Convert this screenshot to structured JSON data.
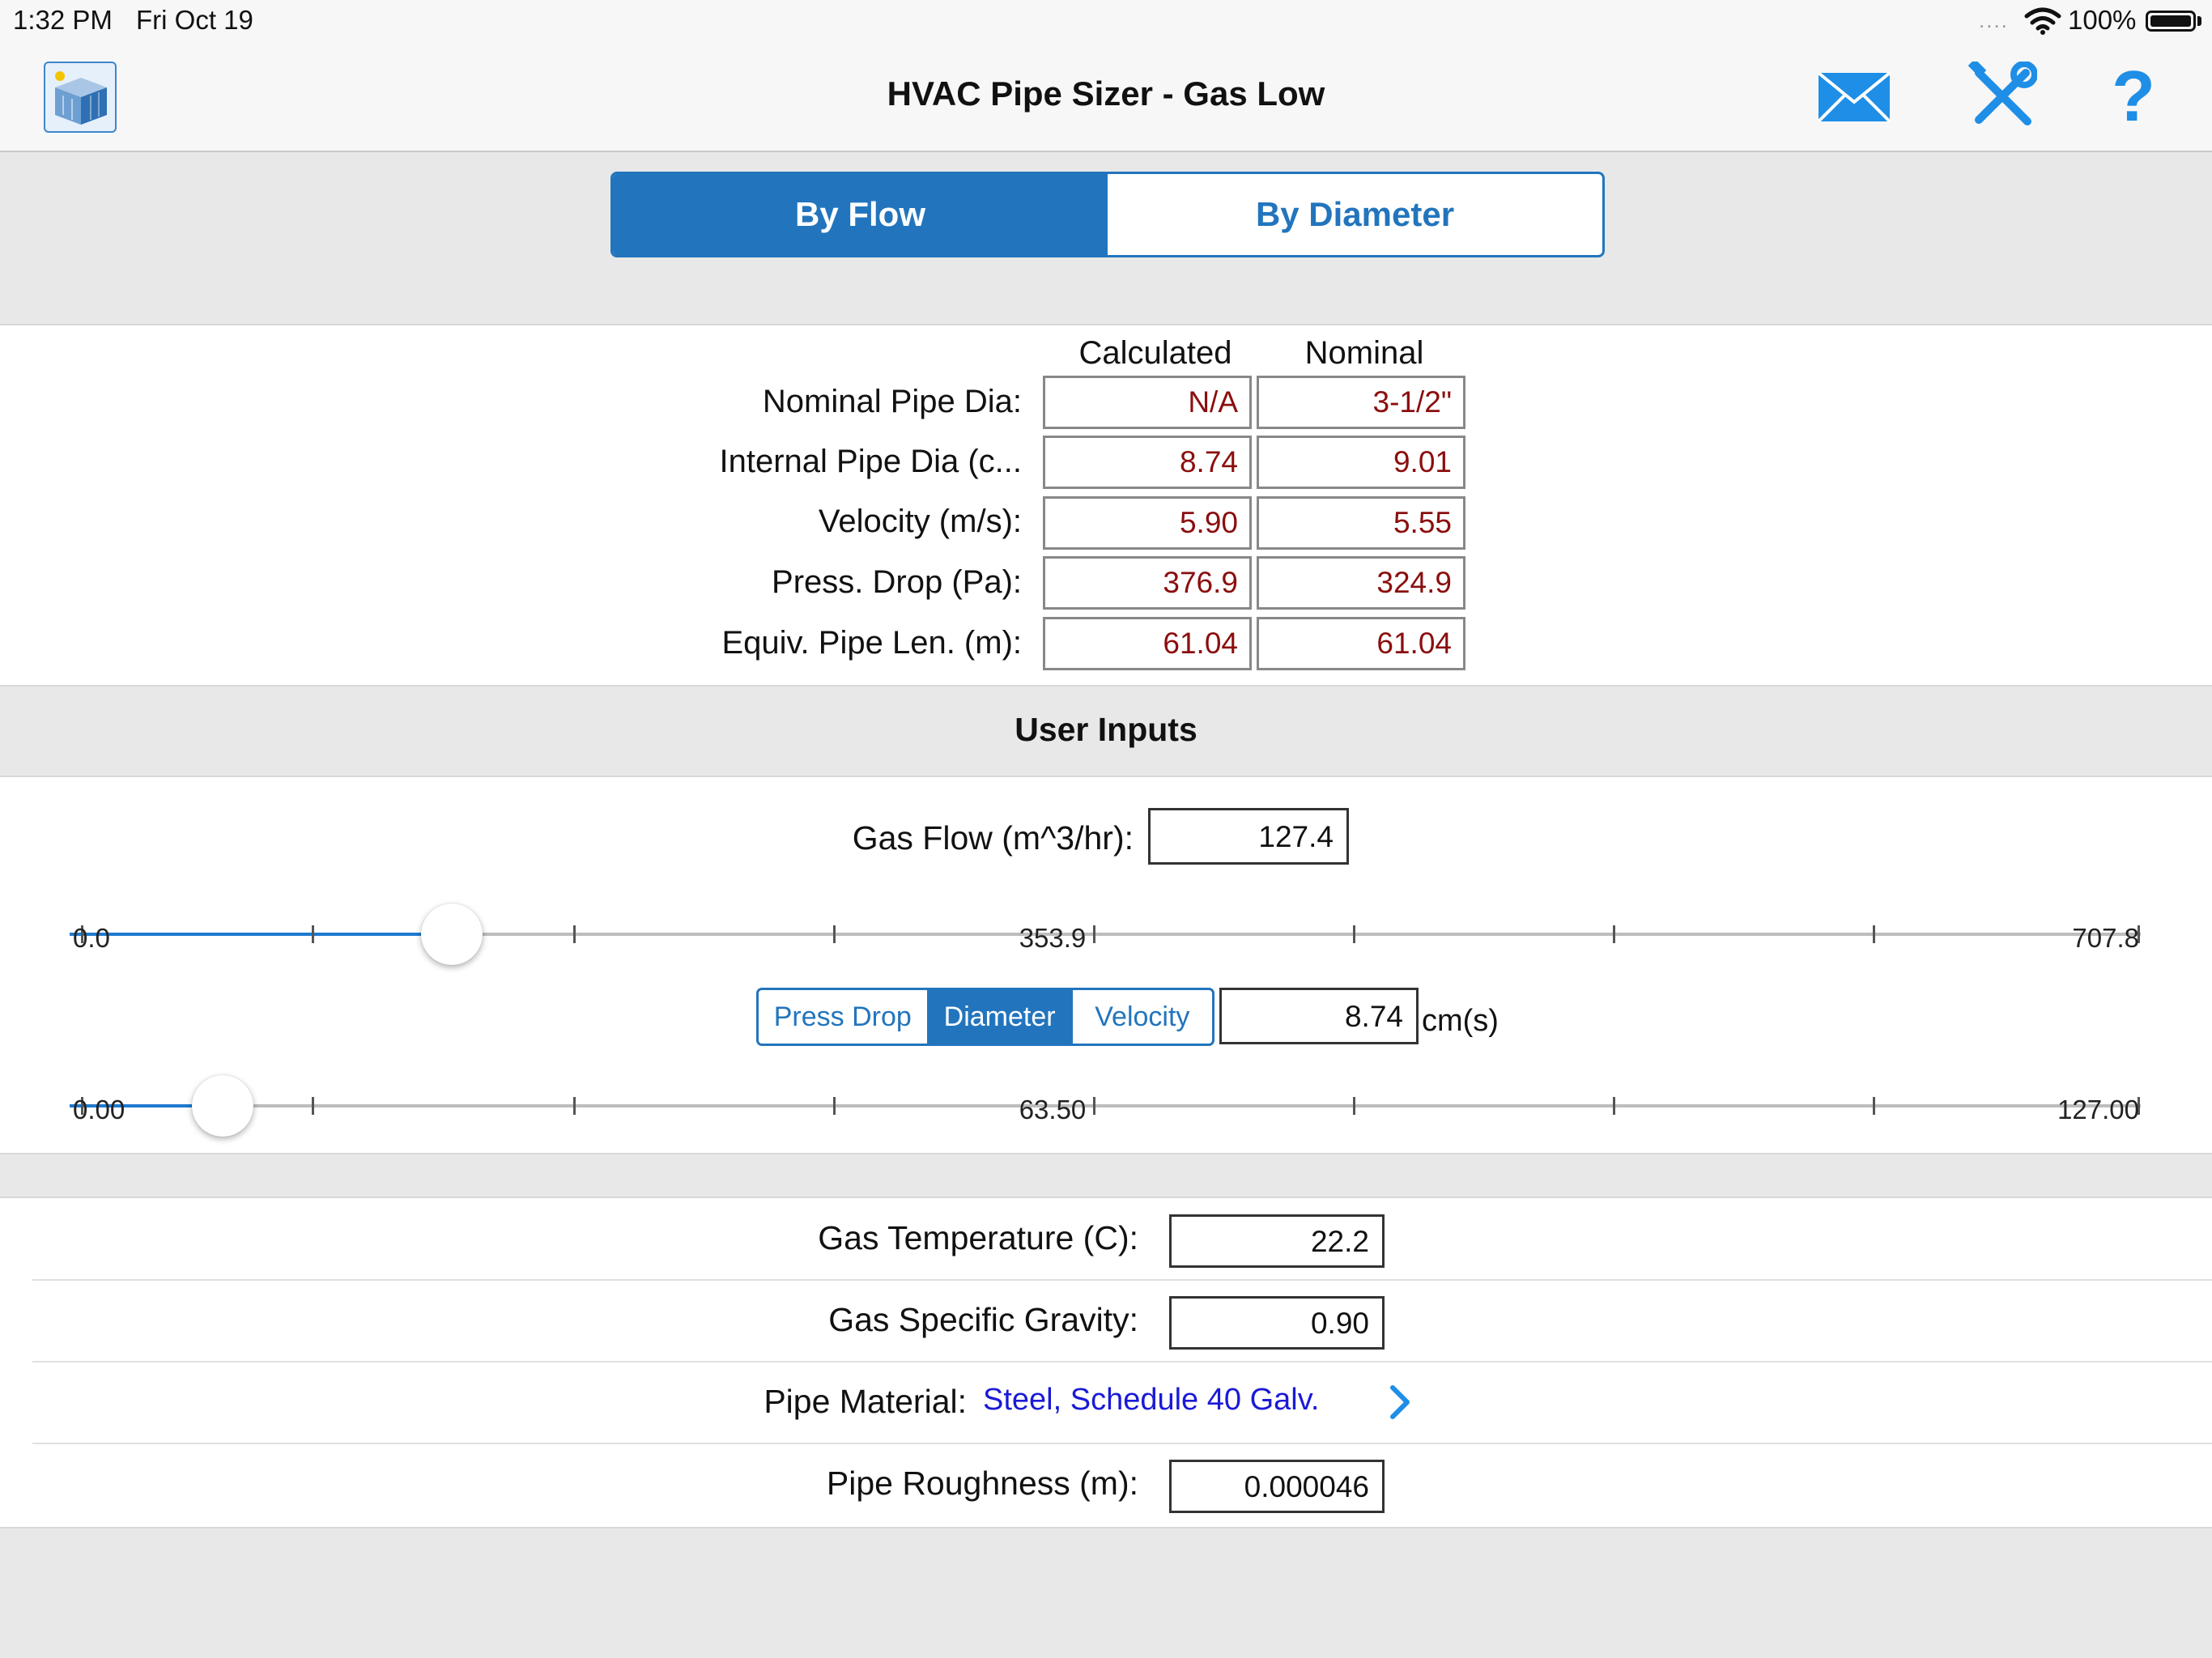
{
  "status": {
    "time": "1:32 PM",
    "date": "Fri Oct 19",
    "signal_dots": "....",
    "battery": "100%"
  },
  "nav": {
    "title": "HVAC Pipe Sizer - Gas Low",
    "icons": [
      "app-logo-icon",
      "mail-icon",
      "tools-icon",
      "help-icon"
    ],
    "help_glyph": "?"
  },
  "mode_tabs": {
    "by_flow": "By Flow",
    "by_diameter": "By Diameter",
    "selected": "By Flow"
  },
  "results": {
    "headers": {
      "calculated": "Calculated",
      "nominal": "Nominal"
    },
    "rows": [
      {
        "label": "Nominal Pipe Dia:",
        "calculated": "N/A",
        "nominal": "3-1/2\""
      },
      {
        "label": "Internal Pipe Dia (c...",
        "calculated": "8.74",
        "nominal": "9.01"
      },
      {
        "label": "Velocity (m/s):",
        "calculated": "5.90",
        "nominal": "5.55"
      },
      {
        "label": "Press. Drop (Pa):",
        "calculated": "376.9",
        "nominal": "324.9"
      },
      {
        "label": "Equiv. Pipe Len. (m):",
        "calculated": "61.04",
        "nominal": "61.04"
      }
    ]
  },
  "user_inputs": {
    "title": "User Inputs",
    "gas_flow": {
      "label": "Gas Flow (m^3/hr):",
      "value": "127.4",
      "slider": {
        "min_label": "0.0",
        "mid_label": "353.9",
        "max_label": "707.8",
        "min": 0.0,
        "max": 707.8,
        "value": 127.4
      }
    },
    "calc_mode": {
      "options": [
        "Press Drop",
        "Diameter",
        "Velocity"
      ],
      "selected": "Diameter",
      "value": "8.74",
      "unit": "cm(s)",
      "slider": {
        "min_label": "0.00",
        "mid_label": "63.50",
        "max_label": "127.00",
        "min": 0.0,
        "max": 127.0,
        "value": 8.74
      }
    }
  },
  "properties": {
    "gas_temperature": {
      "label": "Gas Temperature (C):",
      "value": "22.2"
    },
    "gas_specific_gravity": {
      "label": "Gas Specific Gravity:",
      "value": "0.90"
    },
    "pipe_material": {
      "label": "Pipe Material:",
      "value": "Steel, Schedule 40 Galv."
    },
    "pipe_roughness": {
      "label": "Pipe Roughness (m):",
      "value": "0.000046"
    }
  },
  "colors": {
    "accent": "#2275bd",
    "result_text": "#8b0e0e",
    "link": "#1a1ad6",
    "slider_fill": "#1f7ad0"
  }
}
